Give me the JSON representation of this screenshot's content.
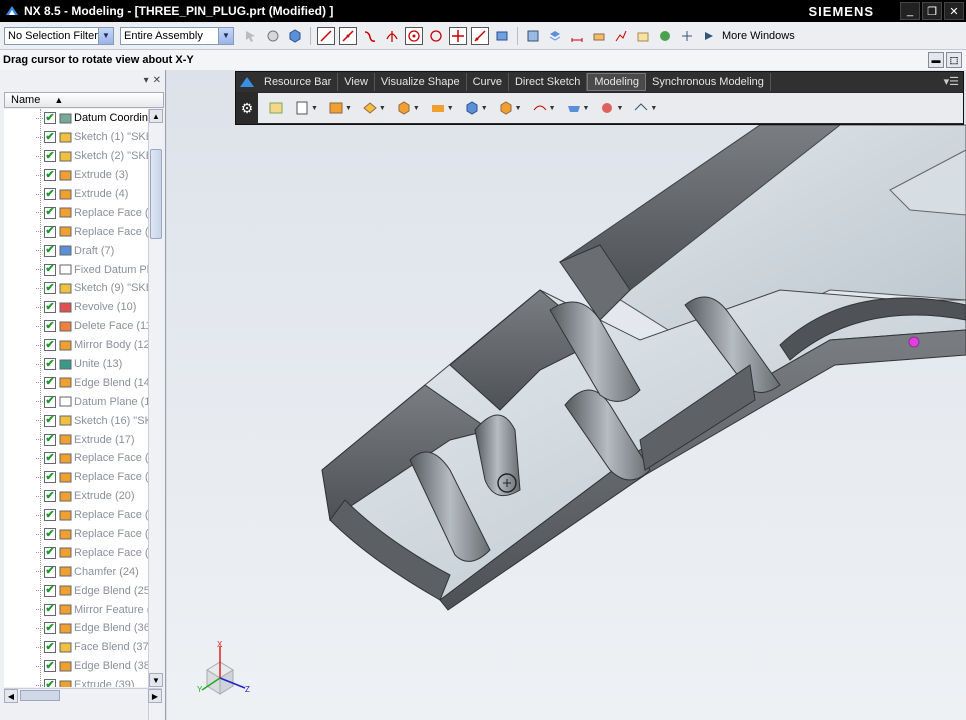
{
  "window": {
    "title": "NX 8.5 - Modeling - [THREE_PIN_PLUG.prt (Modified) ]",
    "brand": "SIEMENS",
    "controls": [
      "minimize",
      "restore",
      "close"
    ]
  },
  "toolbar": {
    "selection_filter": "No Selection Filter",
    "scope": "Entire Assembly",
    "more_windows": "More Windows"
  },
  "status": {
    "message": "Drag cursor to rotate view about X-Y"
  },
  "navigator": {
    "column_name": "Name",
    "items": [
      {
        "label": "Datum Coordina",
        "icon": "datum-csys-icon",
        "checked": true
      },
      {
        "label": "Sketch (1) \"SKE",
        "icon": "sketch-icon",
        "checked": true
      },
      {
        "label": "Sketch (2) \"SKE",
        "icon": "sketch-icon",
        "checked": true
      },
      {
        "label": "Extrude (3)",
        "icon": "extrude-icon",
        "checked": true
      },
      {
        "label": "Extrude (4)",
        "icon": "extrude-icon",
        "checked": true
      },
      {
        "label": "Replace Face (5",
        "icon": "replace-face-icon",
        "checked": true
      },
      {
        "label": "Replace Face (6",
        "icon": "replace-face-icon",
        "checked": true
      },
      {
        "label": "Draft (7)",
        "icon": "draft-icon",
        "checked": true
      },
      {
        "label": "Fixed Datum Pla",
        "icon": "datum-plane-icon",
        "checked": true
      },
      {
        "label": "Sketch (9) \"SKE",
        "icon": "sketch-icon",
        "checked": true
      },
      {
        "label": "Revolve (10)",
        "icon": "revolve-icon",
        "checked": true
      },
      {
        "label": "Delete Face (11",
        "icon": "delete-face-icon",
        "checked": true
      },
      {
        "label": "Mirror Body (12)",
        "icon": "mirror-body-icon",
        "checked": true
      },
      {
        "label": "Unite (13)",
        "icon": "unite-icon",
        "checked": true
      },
      {
        "label": "Edge Blend (14)",
        "icon": "edge-blend-icon",
        "checked": true
      },
      {
        "label": "Datum Plane (15",
        "icon": "datum-plane-icon",
        "checked": true
      },
      {
        "label": "Sketch (16) \"SKE",
        "icon": "sketch-icon",
        "checked": true
      },
      {
        "label": "Extrude (17)",
        "icon": "extrude-icon",
        "checked": true
      },
      {
        "label": "Replace Face (1",
        "icon": "replace-face-icon",
        "checked": true
      },
      {
        "label": "Replace Face (1",
        "icon": "replace-face-icon",
        "checked": true
      },
      {
        "label": "Extrude (20)",
        "icon": "extrude-icon",
        "checked": true
      },
      {
        "label": "Replace Face (2",
        "icon": "replace-face-icon",
        "checked": true
      },
      {
        "label": "Replace Face (2",
        "icon": "replace-face-icon",
        "checked": true
      },
      {
        "label": "Replace Face (2",
        "icon": "replace-face-icon",
        "checked": true
      },
      {
        "label": "Chamfer (24)",
        "icon": "chamfer-icon",
        "checked": true
      },
      {
        "label": "Edge Blend (25)",
        "icon": "edge-blend-icon",
        "checked": true
      },
      {
        "label": "Mirror Feature (",
        "icon": "mirror-feature-icon",
        "checked": true
      },
      {
        "label": "Edge Blend (36)",
        "icon": "edge-blend-icon",
        "checked": true
      },
      {
        "label": "Face Blend (37)",
        "icon": "face-blend-icon",
        "checked": true
      },
      {
        "label": "Edge Blend (38)",
        "icon": "edge-blend-icon",
        "checked": true
      },
      {
        "label": "Extrude (39)",
        "icon": "extrude-icon",
        "checked": true
      }
    ]
  },
  "ribbon": {
    "tabs": [
      "Resource Bar",
      "View",
      "Visualize Shape",
      "Curve",
      "Direct Sketch",
      "Modeling",
      "Synchronous Modeling"
    ],
    "active_tab": "Modeling"
  },
  "triad": {
    "x_label": "X",
    "y_label": "Y",
    "z_label": "Z"
  },
  "colors": {
    "accent": "#316ac5",
    "check": "#1a9a2a",
    "model_face": "#cdd6de",
    "model_side": "#5e6266"
  }
}
